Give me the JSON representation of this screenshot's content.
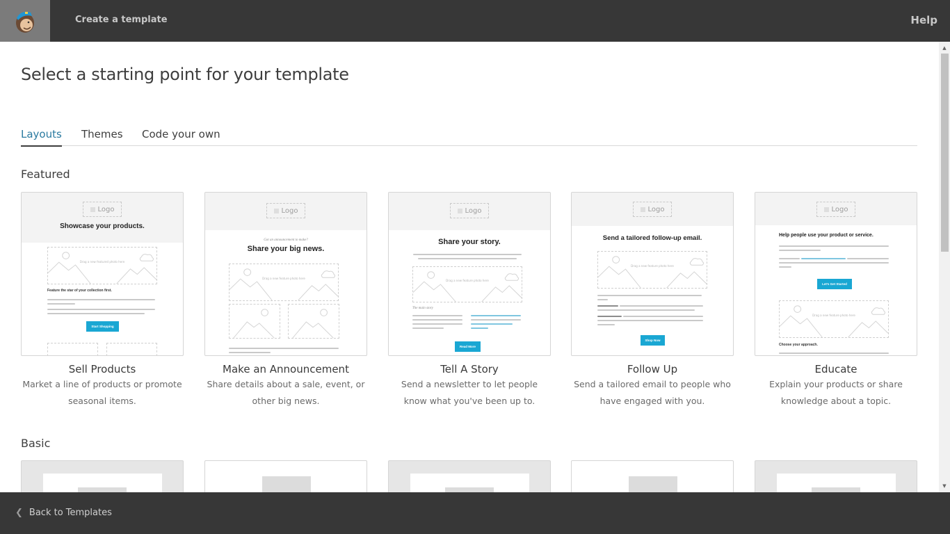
{
  "topbar": {
    "logo_icon": "mailchimp-freddie-logo",
    "title": "Create a template",
    "help_label": "Help"
  },
  "page": {
    "title": "Select a starting point for your template"
  },
  "tabs": [
    {
      "label": "Layouts",
      "active": true
    },
    {
      "label": "Themes",
      "active": false
    },
    {
      "label": "Code your own",
      "active": false
    }
  ],
  "sections": {
    "featured": "Featured",
    "basic": "Basic"
  },
  "featured": [
    {
      "name": "Sell Products",
      "description": "Market a line of products or promote seasonal items.",
      "preview": {
        "logo": "Logo",
        "headline": "Showcase your products.",
        "image_placeholder": "Drag a new featured photo here",
        "subheading": "Feature the star of your collection first.",
        "button": "Start Shopping"
      }
    },
    {
      "name": "Make an Announcement",
      "description": "Share details about a sale, event, or other big news.",
      "preview": {
        "logo": "Logo",
        "kicker": "Got an announcement to make?",
        "headline": "Share your big news.",
        "image_placeholder": "Drag a new feature photo here"
      }
    },
    {
      "name": "Tell A Story",
      "description": "Send a newsletter to let people know what you've been up to.",
      "preview": {
        "logo": "Logo",
        "headline": "Share your story.",
        "image_placeholder": "Drag a new feature photo here",
        "kicker": "The main story",
        "button": "Read More"
      }
    },
    {
      "name": "Follow Up",
      "description": "Send a tailored email to people who have engaged with you.",
      "preview": {
        "logo": "Logo",
        "headline": "Send a tailored follow-up email.",
        "image_placeholder": "Drag a new feature photo here",
        "button": "Shop Now"
      }
    },
    {
      "name": "Educate",
      "description": "Explain your products or share knowledge about a topic.",
      "preview": {
        "logo": "Logo",
        "headline": "Help people use your product or service.",
        "button": "Let's Get Started",
        "image_placeholder": "Drag a new feature photo here",
        "subheading": "Choose your approach."
      }
    }
  ],
  "basic_count": 5,
  "footer": {
    "back_label": "Back to Templates"
  },
  "colors": {
    "bar_bg": "#373737",
    "accent_tab": "#2a7aa0",
    "preview_button": "#1aa7d3"
  }
}
